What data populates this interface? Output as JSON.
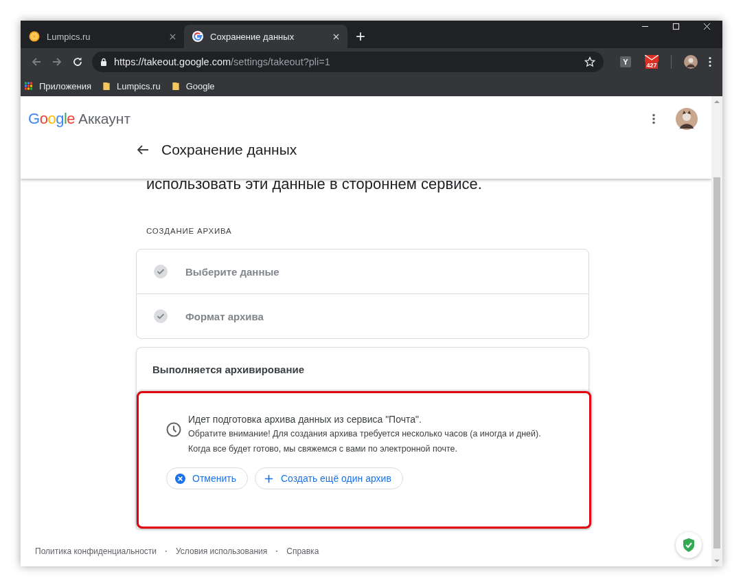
{
  "browser": {
    "tabs": [
      {
        "title": "Lumpics.ru",
        "kind": "orange",
        "selected": false
      },
      {
        "title": "Сохранение данных",
        "kind": "google",
        "selected": true
      }
    ],
    "new_tab": "+",
    "address": {
      "host": "https://takeout.google.com",
      "path": "/settings/takeout?pli=1"
    },
    "extensions": [
      {
        "kind": "letter",
        "label": "Y"
      },
      {
        "kind": "mail",
        "label": "427"
      }
    ],
    "bookmarks": [
      {
        "kind": "apps",
        "label": "Приложения"
      },
      {
        "kind": "folder",
        "label": "Lumpics.ru"
      },
      {
        "kind": "folder",
        "label": "Google"
      }
    ]
  },
  "header": {
    "brand": "Google",
    "product": "Аккаунт",
    "page_title": "Сохранение данных"
  },
  "intro": "использовать эти данные в стороннем сервисе.",
  "section_label": "СОЗДАНИЕ АРХИВА",
  "steps": [
    {
      "label": "Выберите данные",
      "done": true
    },
    {
      "label": "Формат архива",
      "done": true
    }
  ],
  "progress": {
    "title": "Выполняется архивирование",
    "highlighted": true,
    "status": "Идет подготовка архива данных из сервиса \"Почта\".",
    "note": "Обратите внимание! Для создания архива требуется несколько часов (а иногда и дней). Когда все будет готово, мы свяжемся с вами по электронной почте.",
    "actions": [
      {
        "kind": "cancel",
        "label": "Отменить"
      },
      {
        "kind": "create",
        "label": "Создать ещё один архив"
      }
    ]
  },
  "footer": [
    {
      "kind": "link",
      "text": "Политика конфиденциальности"
    },
    {
      "kind": "sep",
      "text": "·"
    },
    {
      "kind": "link",
      "text": "Условия использования"
    },
    {
      "kind": "sep",
      "text": "·"
    },
    {
      "kind": "link",
      "text": "Справка"
    }
  ]
}
